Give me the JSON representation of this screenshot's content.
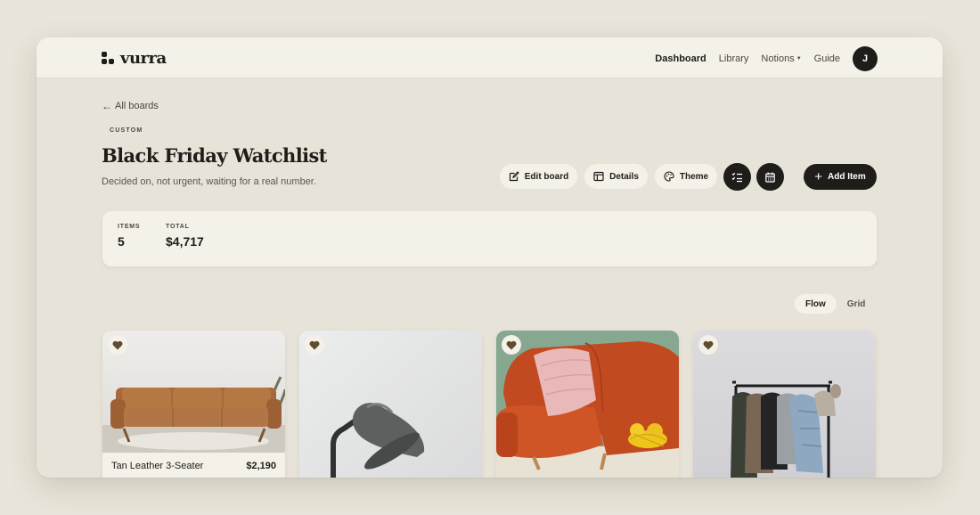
{
  "brand": {
    "name": "vurra"
  },
  "nav": {
    "items": [
      "Dashboard",
      "Library",
      "Notions",
      "Guide"
    ],
    "avatar_initial": "J"
  },
  "board": {
    "back_label": "All boards",
    "category": "CUSTOM",
    "title": "Black Friday Watchlist",
    "description": "Decided on, not urgent, waiting for a real number."
  },
  "toolbar": {
    "edit_label": "Edit board",
    "details_label": "Details",
    "theme_label": "Theme",
    "add_label": "Add Item"
  },
  "stats": {
    "items_label": "ITEMS",
    "items_value": "5",
    "total_label": "TOTAL",
    "total_value": "$4,717"
  },
  "view": {
    "options": [
      "Flow",
      "Grid"
    ],
    "selected": "Flow"
  },
  "cards": [
    {
      "name": "Tan Leather 3-Seater",
      "price": "$2,190",
      "image": "tan leather sofa"
    },
    {
      "name": "",
      "price": "",
      "image": "grey desk lamp"
    },
    {
      "name": "",
      "price": "",
      "image": "orange sofa with pink pillow"
    },
    {
      "name": "",
      "price": "",
      "image": "clothing rack"
    }
  ],
  "colors": {
    "accent": "#1f1d1a",
    "page_bg": "#e7e3d8",
    "surface": "#f4f1e8",
    "heart": "#5e4d2f"
  }
}
